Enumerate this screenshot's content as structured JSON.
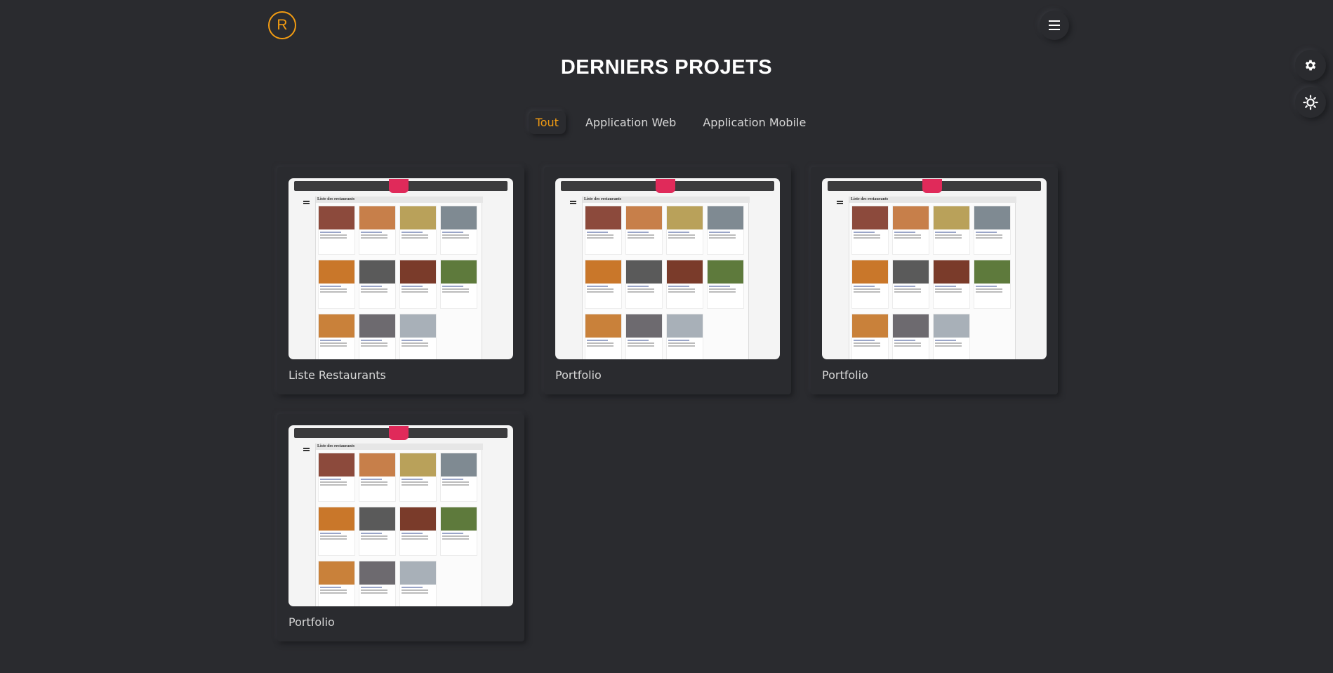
{
  "header": {
    "logo_letter": "R",
    "menu_icon": "hamburger-menu-icon",
    "accent_color": "#f39c12"
  },
  "side_controls": {
    "settings_icon": "gear-icon",
    "theme_icon": "sun-icon"
  },
  "section": {
    "title": "DERNIERS PROJETS"
  },
  "filters": [
    {
      "label": "Tout",
      "active": true
    },
    {
      "label": "Application Web",
      "active": false
    },
    {
      "label": "Application Mobile",
      "active": false
    }
  ],
  "projects": [
    {
      "title": "Liste Restaurants",
      "thumb_heading": "Liste des restaurants"
    },
    {
      "title": "Portfolio",
      "thumb_heading": "Liste des restaurants"
    },
    {
      "title": "Portfolio",
      "thumb_heading": "Liste des restaurants"
    },
    {
      "title": "Portfolio",
      "thumb_heading": "Liste des restaurants"
    }
  ]
}
